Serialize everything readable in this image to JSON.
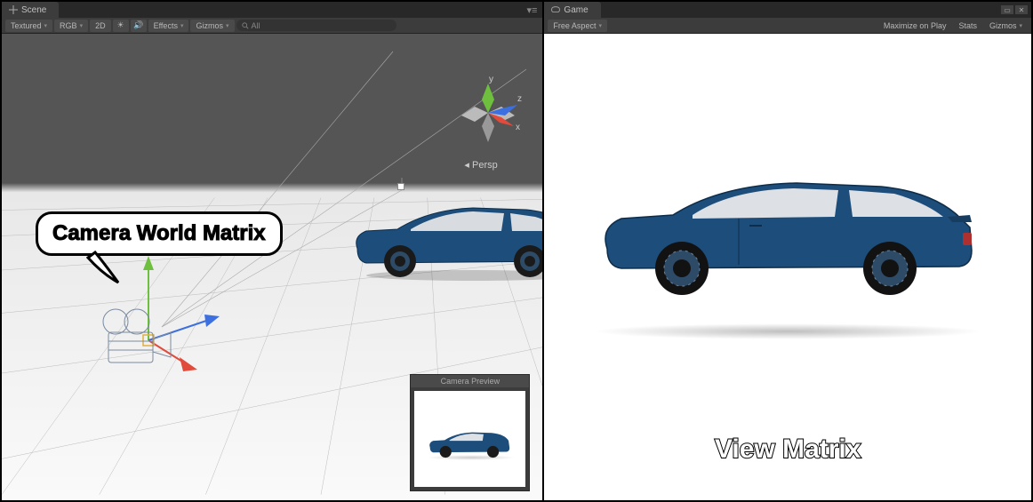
{
  "scene_panel": {
    "tab_label": "Scene",
    "toolbar": {
      "shading": "Textured",
      "render_mode": "RGB",
      "mode_2d": "2D",
      "effects": "Effects",
      "gizmos": "Gizmos",
      "search_placeholder": "All"
    },
    "axis_gizmo": {
      "x": "x",
      "y": "y",
      "z": "z",
      "projection": "Persp"
    },
    "annotation_bubble": "Camera World Matrix",
    "camera_preview_title": "Camera Preview"
  },
  "game_panel": {
    "tab_label": "Game",
    "toolbar": {
      "aspect": "Free Aspect",
      "maximize": "Maximize on Play",
      "stats": "Stats",
      "gizmos": "Gizmos"
    },
    "annotation_label": "View Matrix"
  },
  "colors": {
    "car_body": "#1d4d7a",
    "axis_x": "#e04b3c",
    "axis_y": "#6fbf3f",
    "axis_z": "#3c6fe0"
  }
}
